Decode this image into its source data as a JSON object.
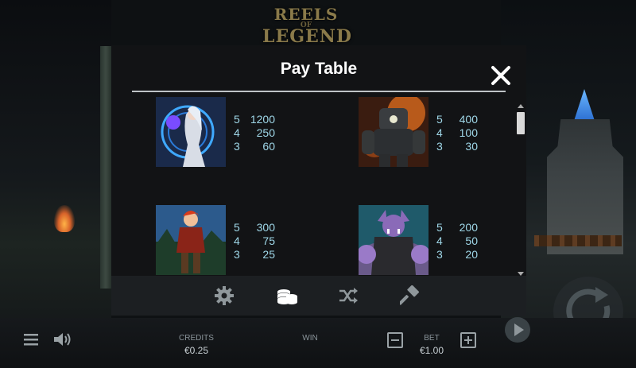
{
  "logo": {
    "line1": "REELS",
    "line2": "OF",
    "line3": "LEGEND"
  },
  "paytable": {
    "title": "Pay Table",
    "entries": [
      {
        "symbol": "sorceress-symbol",
        "pays": [
          {
            "count": "5",
            "amount": "1200"
          },
          {
            "count": "4",
            "amount": "250"
          },
          {
            "count": "3",
            "amount": "60"
          }
        ]
      },
      {
        "symbol": "golem-symbol",
        "pays": [
          {
            "count": "5",
            "amount": "400"
          },
          {
            "count": "4",
            "amount": "100"
          },
          {
            "count": "3",
            "amount": "30"
          }
        ]
      },
      {
        "symbol": "red-haired-hero-symbol",
        "pays": [
          {
            "count": "5",
            "amount": "300"
          },
          {
            "count": "4",
            "amount": "75"
          },
          {
            "count": "3",
            "amount": "25"
          }
        ]
      },
      {
        "symbol": "purple-orc-symbol",
        "pays": [
          {
            "count": "5",
            "amount": "200"
          },
          {
            "count": "4",
            "amount": "50"
          },
          {
            "count": "3",
            "amount": "20"
          }
        ]
      }
    ]
  },
  "toolbar": {
    "icons": [
      "gear-icon",
      "coins-icon",
      "shuffle-icon",
      "hammer-icon"
    ],
    "active": "coins-icon"
  },
  "bottom": {
    "credits_label": "CREDITS",
    "credits_value": "€0.25",
    "win_label": "WIN",
    "bet_label": "BET",
    "bet_value": "€1.00"
  },
  "colors": {
    "panel_bg": "#121315",
    "pay_text": "#9fd7e8",
    "toolbar_bg": "#1c1f22"
  }
}
